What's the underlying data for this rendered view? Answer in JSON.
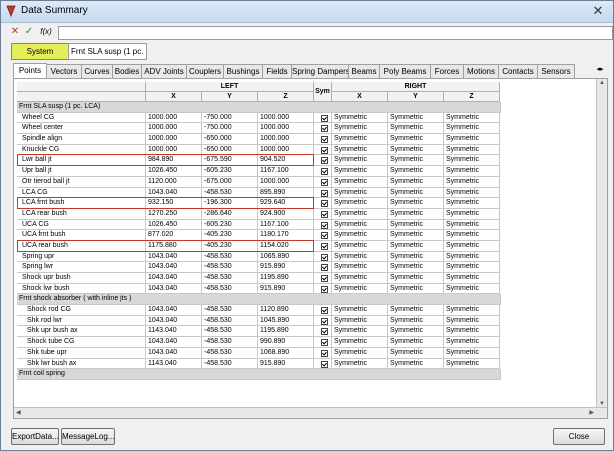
{
  "window": {
    "title": "Data Summary",
    "close_glyph": "✕"
  },
  "toolbar": {
    "cancel_glyph": "✕",
    "apply_glyph": "✓",
    "fx_label": "f(x)",
    "expression_value": ""
  },
  "system": {
    "button_label": "System",
    "field_value": "Frnt SLA susp (1 pc. LCA"
  },
  "tabs": [
    {
      "label": "Points",
      "active": true
    },
    {
      "label": "Vectors"
    },
    {
      "label": "Curves"
    },
    {
      "label": "Bodies"
    },
    {
      "label": "ADV Joints"
    },
    {
      "label": "Couplers"
    },
    {
      "label": "Bushings"
    },
    {
      "label": "Fields"
    },
    {
      "label": "Spring Dampers"
    },
    {
      "label": "Beams"
    },
    {
      "label": "Poly Beams"
    },
    {
      "label": "Forces"
    },
    {
      "label": "Motions"
    },
    {
      "label": "Contacts"
    },
    {
      "label": "Sensors"
    }
  ],
  "tab_scroll": "◂▸",
  "grid": {
    "header_left": "LEFT",
    "header_sym": "Sym",
    "header_right": "RIGHT",
    "col_x": "X",
    "col_y": "Y",
    "col_z": "Z",
    "rows": [
      {
        "group": true,
        "name": "Frnt SLA susp (1 pc. LCA)"
      },
      {
        "name": "Wheel CG",
        "x": "1000.000",
        "y": "-750.000",
        "z": "1000.000",
        "rx": "Symmetric",
        "ry": "Symmetric",
        "rz": "Symmetric"
      },
      {
        "name": "Wheel center",
        "x": "1000.000",
        "y": "-750.000",
        "z": "1000.000",
        "rx": "Symmetric",
        "ry": "Symmetric",
        "rz": "Symmetric"
      },
      {
        "name": "Spindle align",
        "x": "1000.000",
        "y": "-650.000",
        "z": "1000.000",
        "rx": "Symmetric",
        "ry": "Symmetric",
        "rz": "Symmetric"
      },
      {
        "name": "Knuckle CG",
        "x": "1000.000",
        "y": "-650.000",
        "z": "1000.000",
        "rx": "Symmetric",
        "ry": "Symmetric",
        "rz": "Symmetric"
      },
      {
        "name": "Lwr ball jt",
        "x": "984.890",
        "y": "-675.590",
        "z": "904.520",
        "rx": "Symmetric",
        "ry": "Symmetric",
        "rz": "Symmetric",
        "hl": true
      },
      {
        "name": "Upr ball jt",
        "x": "1026.450",
        "y": "-605.230",
        "z": "1167.100",
        "rx": "Symmetric",
        "ry": "Symmetric",
        "rz": "Symmetric"
      },
      {
        "name": "Otr tierod ball jt",
        "x": "1120.000",
        "y": "-675.000",
        "z": "1000.000",
        "rx": "Symmetric",
        "ry": "Symmetric",
        "rz": "Symmetric"
      },
      {
        "name": "LCA CG",
        "x": "1043.040",
        "y": "-458.530",
        "z": "895.890",
        "rx": "Symmetric",
        "ry": "Symmetric",
        "rz": "Symmetric"
      },
      {
        "name": "LCA frnt bush",
        "x": "932.150",
        "y": "-196.300",
        "z": "929.640",
        "rx": "Symmetric",
        "ry": "Symmetric",
        "rz": "Symmetric",
        "hl": true
      },
      {
        "name": "LCA rear bush",
        "x": "1270.250",
        "y": "-286.640",
        "z": "924.900",
        "rx": "Symmetric",
        "ry": "Symmetric",
        "rz": "Symmetric"
      },
      {
        "name": "UCA CG",
        "x": "1026.450",
        "y": "-605.230",
        "z": "1167.100",
        "rx": "Symmetric",
        "ry": "Symmetric",
        "rz": "Symmetric"
      },
      {
        "name": "UCA frnt bush",
        "x": "877.020",
        "y": "-405.230",
        "z": "1180.170",
        "rx": "Symmetric",
        "ry": "Symmetric",
        "rz": "Symmetric"
      },
      {
        "name": "UCA rear bush",
        "x": "1175.880",
        "y": "-405.230",
        "z": "1154.020",
        "rx": "Symmetric",
        "ry": "Symmetric",
        "rz": "Symmetric",
        "hl": true
      },
      {
        "name": "Spring upr",
        "x": "1043.040",
        "y": "-458.530",
        "z": "1065.890",
        "rx": "Symmetric",
        "ry": "Symmetric",
        "rz": "Symmetric"
      },
      {
        "name": "Spring lwr",
        "x": "1043.040",
        "y": "-458.530",
        "z": "915.890",
        "rx": "Symmetric",
        "ry": "Symmetric",
        "rz": "Symmetric"
      },
      {
        "name": "Shock upr bush",
        "x": "1043.040",
        "y": "-458.530",
        "z": "1195.890",
        "rx": "Symmetric",
        "ry": "Symmetric",
        "rz": "Symmetric"
      },
      {
        "name": "Shock lwr bush",
        "x": "1043.040",
        "y": "-458.530",
        "z": "915.890",
        "rx": "Symmetric",
        "ry": "Symmetric",
        "rz": "Symmetric"
      },
      {
        "group": true,
        "name": "Frnt shock absorber ( with inline jts )"
      },
      {
        "name": "Shock rod CG",
        "indent": true,
        "x": "1043.040",
        "y": "-458.530",
        "z": "1120.890",
        "rx": "Symmetric",
        "ry": "Symmetric",
        "rz": "Symmetric"
      },
      {
        "name": "Shk rod lwr",
        "indent": true,
        "x": "1043.040",
        "y": "-458.530",
        "z": "1045.890",
        "rx": "Symmetric",
        "ry": "Symmetric",
        "rz": "Symmetric"
      },
      {
        "name": "Shk upr bush ax",
        "indent": true,
        "x": "1143.040",
        "y": "-458.530",
        "z": "1195.890",
        "rx": "Symmetric",
        "ry": "Symmetric",
        "rz": "Symmetric"
      },
      {
        "name": "Shock tube CG",
        "indent": true,
        "x": "1043.040",
        "y": "-458.530",
        "z": "990.890",
        "rx": "Symmetric",
        "ry": "Symmetric",
        "rz": "Symmetric"
      },
      {
        "name": "Shk tube upr",
        "indent": true,
        "x": "1043.040",
        "y": "-458.530",
        "z": "1068.890",
        "rx": "Symmetric",
        "ry": "Symmetric",
        "rz": "Symmetric"
      },
      {
        "name": "Shk lwr bush ax",
        "indent": true,
        "x": "1143.040",
        "y": "-458.530",
        "z": "915.890",
        "rx": "Symmetric",
        "ry": "Symmetric",
        "rz": "Symmetric"
      },
      {
        "group": true,
        "name": "Frnt coil spring"
      }
    ]
  },
  "buttons": {
    "export": "ExportData...",
    "messagelog": "MessageLog...",
    "close": "Close"
  }
}
